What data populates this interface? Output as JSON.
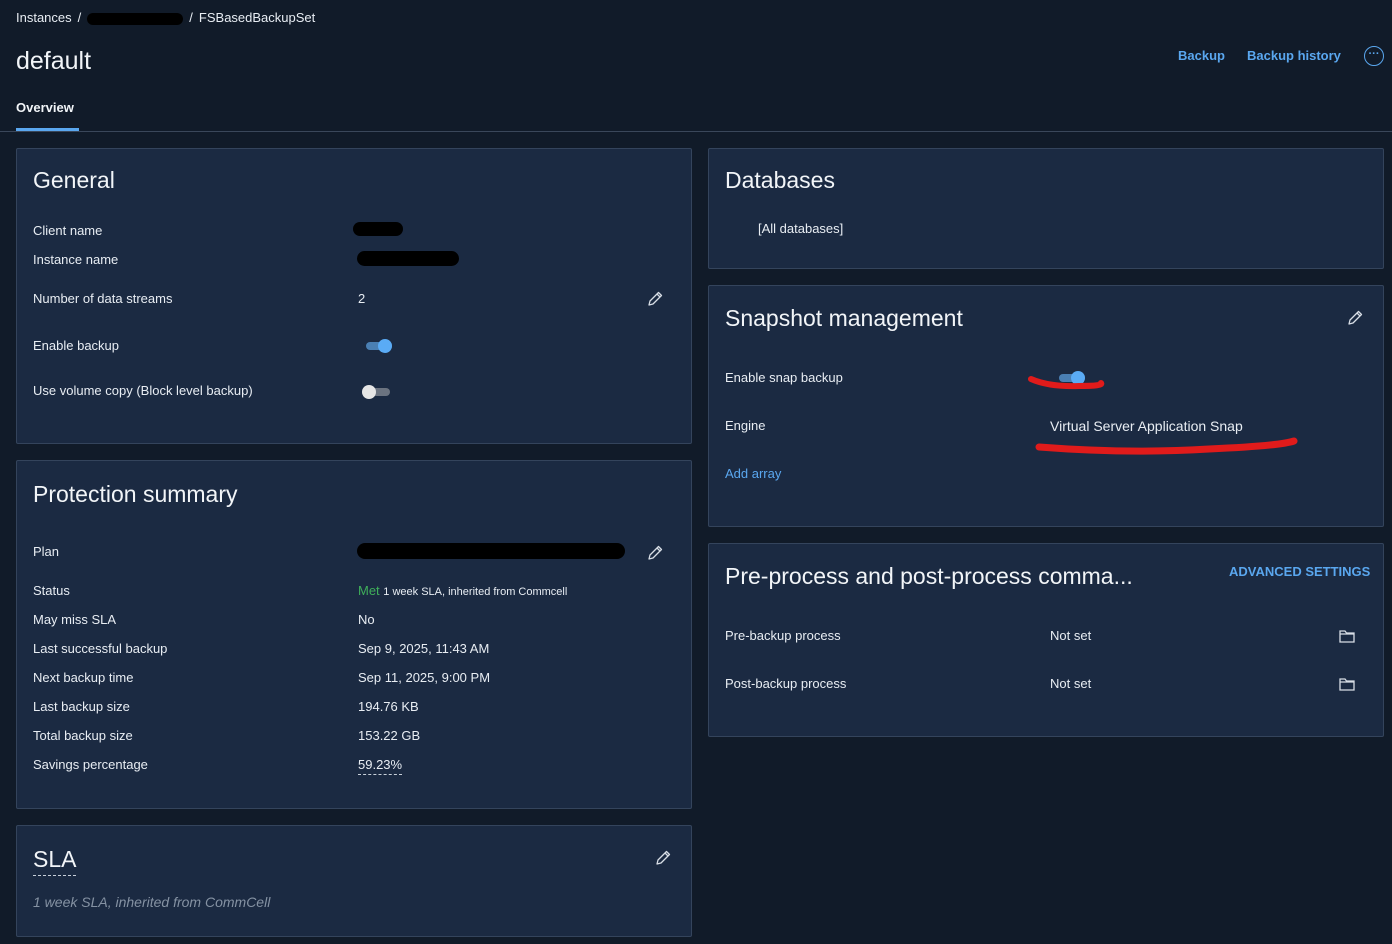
{
  "breadcrumb": {
    "items": [
      "Instances",
      "FSBasedBackupSet"
    ],
    "separator": "/"
  },
  "page_title": "default",
  "header_actions": {
    "backup": "Backup",
    "backup_history": "Backup history",
    "more": "···"
  },
  "tabs": [
    {
      "label": "Overview",
      "active": true
    }
  ],
  "general": {
    "title": "General",
    "client_name_label": "Client name",
    "instance_name_label": "Instance name",
    "data_streams_label": "Number of data streams",
    "data_streams_value": "2",
    "enable_backup_label": "Enable backup",
    "enable_backup": true,
    "volume_copy_label": "Use volume copy (Block level backup)",
    "volume_copy": false
  },
  "protection": {
    "title": "Protection summary",
    "rows": [
      {
        "label": "Plan"
      },
      {
        "label": "Status",
        "status": "Met",
        "value": "1 week SLA, inherited from Commcell"
      },
      {
        "label": "May miss SLA",
        "value": "No"
      },
      {
        "label": "Last successful backup",
        "value": "Sep 9, 2025, 11:43 AM"
      },
      {
        "label": "Next backup time",
        "value": "Sep 11, 2025, 9:00 PM"
      },
      {
        "label": "Last backup size",
        "value": "194.76 KB"
      },
      {
        "label": "Total backup size",
        "value": "153.22 GB"
      },
      {
        "label": "Savings percentage",
        "value": "59.23%"
      }
    ]
  },
  "sla": {
    "title": "SLA",
    "description": "1 week SLA, inherited from CommCell"
  },
  "databases": {
    "title": "Databases",
    "value": "[All databases]"
  },
  "snapshot": {
    "title": "Snapshot management",
    "enable_snap_label": "Enable snap backup",
    "enable_snap": true,
    "engine_label": "Engine",
    "engine_value": "Virtual Server Application Snap",
    "add_array": "Add array"
  },
  "prepost": {
    "title": "Pre-process and post-process comma...",
    "advanced": "ADVANCED SETTINGS",
    "rows": [
      {
        "label": "Pre-backup process",
        "value": "Not set"
      },
      {
        "label": "Post-backup process",
        "value": "Not set"
      }
    ]
  },
  "colors": {
    "accent": "#5aa7ef",
    "met": "#3fae5a",
    "annotation": "#e01b1b"
  }
}
